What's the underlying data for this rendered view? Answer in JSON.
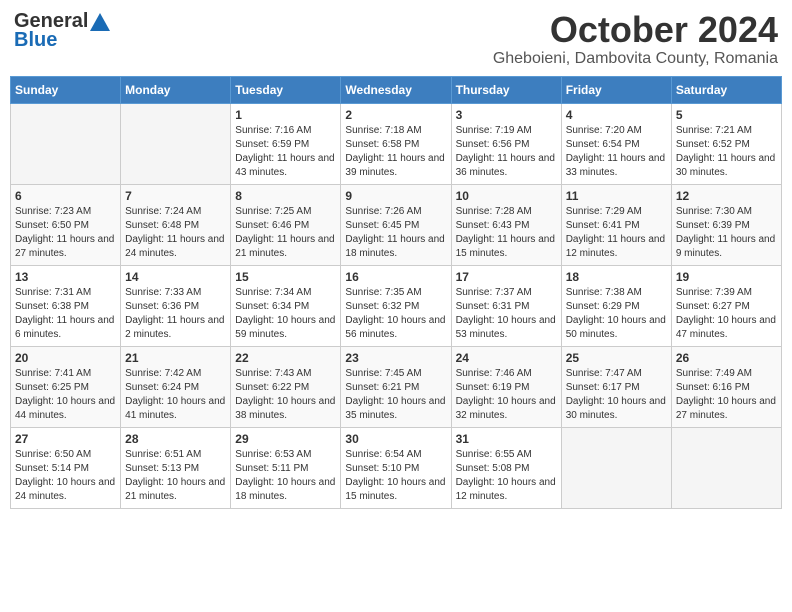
{
  "header": {
    "logo_line1": "General",
    "logo_line2": "Blue",
    "title": "October 2024",
    "subtitle": "Gheboieni, Dambovita County, Romania"
  },
  "weekdays": [
    "Sunday",
    "Monday",
    "Tuesday",
    "Wednesday",
    "Thursday",
    "Friday",
    "Saturday"
  ],
  "weeks": [
    [
      {
        "day": "",
        "info": ""
      },
      {
        "day": "",
        "info": ""
      },
      {
        "day": "1",
        "info": "Sunrise: 7:16 AM\nSunset: 6:59 PM\nDaylight: 11 hours and 43 minutes."
      },
      {
        "day": "2",
        "info": "Sunrise: 7:18 AM\nSunset: 6:58 PM\nDaylight: 11 hours and 39 minutes."
      },
      {
        "day": "3",
        "info": "Sunrise: 7:19 AM\nSunset: 6:56 PM\nDaylight: 11 hours and 36 minutes."
      },
      {
        "day": "4",
        "info": "Sunrise: 7:20 AM\nSunset: 6:54 PM\nDaylight: 11 hours and 33 minutes."
      },
      {
        "day": "5",
        "info": "Sunrise: 7:21 AM\nSunset: 6:52 PM\nDaylight: 11 hours and 30 minutes."
      }
    ],
    [
      {
        "day": "6",
        "info": "Sunrise: 7:23 AM\nSunset: 6:50 PM\nDaylight: 11 hours and 27 minutes."
      },
      {
        "day": "7",
        "info": "Sunrise: 7:24 AM\nSunset: 6:48 PM\nDaylight: 11 hours and 24 minutes."
      },
      {
        "day": "8",
        "info": "Sunrise: 7:25 AM\nSunset: 6:46 PM\nDaylight: 11 hours and 21 minutes."
      },
      {
        "day": "9",
        "info": "Sunrise: 7:26 AM\nSunset: 6:45 PM\nDaylight: 11 hours and 18 minutes."
      },
      {
        "day": "10",
        "info": "Sunrise: 7:28 AM\nSunset: 6:43 PM\nDaylight: 11 hours and 15 minutes."
      },
      {
        "day": "11",
        "info": "Sunrise: 7:29 AM\nSunset: 6:41 PM\nDaylight: 11 hours and 12 minutes."
      },
      {
        "day": "12",
        "info": "Sunrise: 7:30 AM\nSunset: 6:39 PM\nDaylight: 11 hours and 9 minutes."
      }
    ],
    [
      {
        "day": "13",
        "info": "Sunrise: 7:31 AM\nSunset: 6:38 PM\nDaylight: 11 hours and 6 minutes."
      },
      {
        "day": "14",
        "info": "Sunrise: 7:33 AM\nSunset: 6:36 PM\nDaylight: 11 hours and 2 minutes."
      },
      {
        "day": "15",
        "info": "Sunrise: 7:34 AM\nSunset: 6:34 PM\nDaylight: 10 hours and 59 minutes."
      },
      {
        "day": "16",
        "info": "Sunrise: 7:35 AM\nSunset: 6:32 PM\nDaylight: 10 hours and 56 minutes."
      },
      {
        "day": "17",
        "info": "Sunrise: 7:37 AM\nSunset: 6:31 PM\nDaylight: 10 hours and 53 minutes."
      },
      {
        "day": "18",
        "info": "Sunrise: 7:38 AM\nSunset: 6:29 PM\nDaylight: 10 hours and 50 minutes."
      },
      {
        "day": "19",
        "info": "Sunrise: 7:39 AM\nSunset: 6:27 PM\nDaylight: 10 hours and 47 minutes."
      }
    ],
    [
      {
        "day": "20",
        "info": "Sunrise: 7:41 AM\nSunset: 6:25 PM\nDaylight: 10 hours and 44 minutes."
      },
      {
        "day": "21",
        "info": "Sunrise: 7:42 AM\nSunset: 6:24 PM\nDaylight: 10 hours and 41 minutes."
      },
      {
        "day": "22",
        "info": "Sunrise: 7:43 AM\nSunset: 6:22 PM\nDaylight: 10 hours and 38 minutes."
      },
      {
        "day": "23",
        "info": "Sunrise: 7:45 AM\nSunset: 6:21 PM\nDaylight: 10 hours and 35 minutes."
      },
      {
        "day": "24",
        "info": "Sunrise: 7:46 AM\nSunset: 6:19 PM\nDaylight: 10 hours and 32 minutes."
      },
      {
        "day": "25",
        "info": "Sunrise: 7:47 AM\nSunset: 6:17 PM\nDaylight: 10 hours and 30 minutes."
      },
      {
        "day": "26",
        "info": "Sunrise: 7:49 AM\nSunset: 6:16 PM\nDaylight: 10 hours and 27 minutes."
      }
    ],
    [
      {
        "day": "27",
        "info": "Sunrise: 6:50 AM\nSunset: 5:14 PM\nDaylight: 10 hours and 24 minutes."
      },
      {
        "day": "28",
        "info": "Sunrise: 6:51 AM\nSunset: 5:13 PM\nDaylight: 10 hours and 21 minutes."
      },
      {
        "day": "29",
        "info": "Sunrise: 6:53 AM\nSunset: 5:11 PM\nDaylight: 10 hours and 18 minutes."
      },
      {
        "day": "30",
        "info": "Sunrise: 6:54 AM\nSunset: 5:10 PM\nDaylight: 10 hours and 15 minutes."
      },
      {
        "day": "31",
        "info": "Sunrise: 6:55 AM\nSunset: 5:08 PM\nDaylight: 10 hours and 12 minutes."
      },
      {
        "day": "",
        "info": ""
      },
      {
        "day": "",
        "info": ""
      }
    ]
  ]
}
